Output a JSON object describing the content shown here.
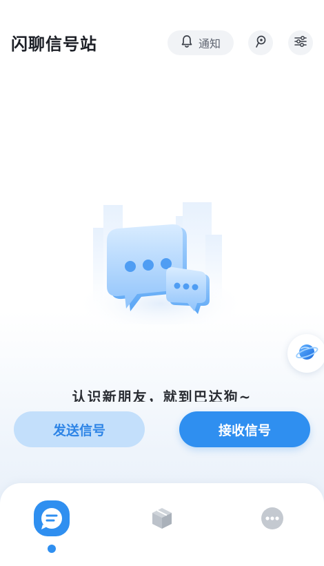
{
  "header": {
    "title": "闪聊信号站",
    "notify_label": "通知",
    "notify_icon": "bell-icon",
    "location_icon": "location-pin-icon",
    "settings_icon": "sliders-icon"
  },
  "main": {
    "illustration": "chat-bubbles-illustration",
    "tagline": "认识新朋友，就到巴达狗~"
  },
  "actions": {
    "send_label": "发送信号",
    "receive_label": "接收信号"
  },
  "floating": {
    "icon": "planet-icon"
  },
  "bottom_nav": {
    "items": [
      {
        "icon": "chat-icon",
        "active": true
      },
      {
        "icon": "cube-icon",
        "active": false
      },
      {
        "icon": "more-icon",
        "active": false
      }
    ]
  },
  "colors": {
    "accent": "#2f8ff0",
    "accent_light": "#c3dffb",
    "text_dark": "#1c1f26"
  }
}
